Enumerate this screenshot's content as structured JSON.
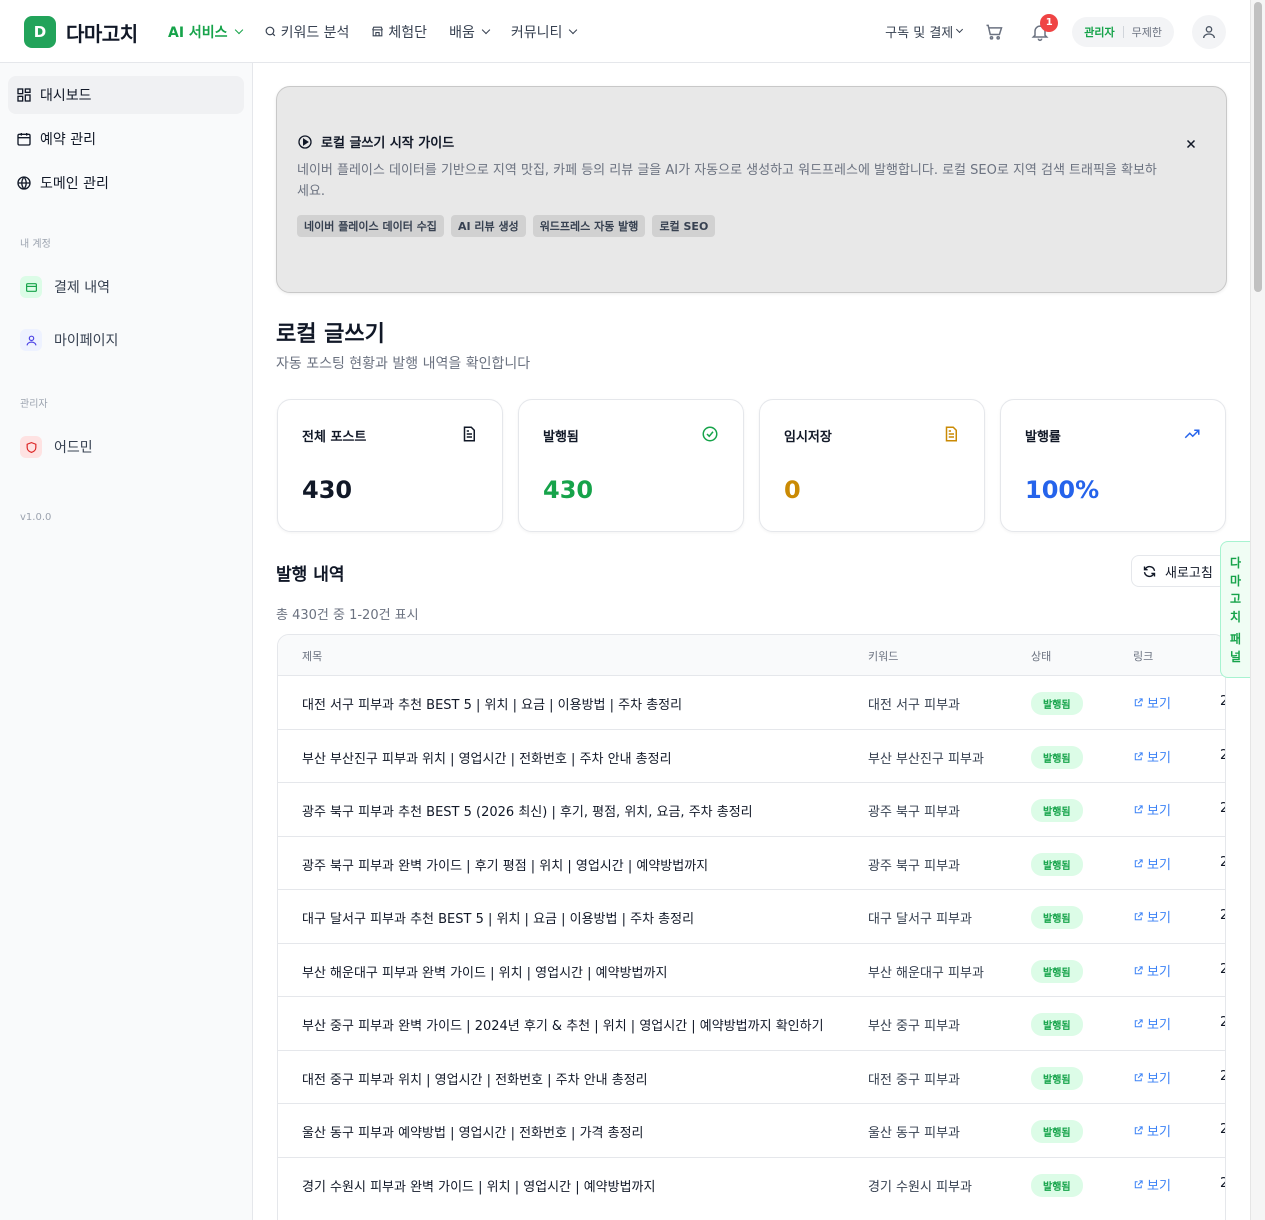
{
  "brand": {
    "badge": "D",
    "name": "다마고치",
    "accent": "#22a35a"
  },
  "nav": [
    {
      "label": "AI 서비스",
      "active": true,
      "dropdown": true,
      "icon": null
    },
    {
      "label": "키워드 분석",
      "active": false,
      "dropdown": false,
      "icon": "search-icon"
    },
    {
      "label": "체험단",
      "active": false,
      "dropdown": false,
      "icon": "store-icon"
    },
    {
      "label": "배움",
      "active": false,
      "dropdown": true,
      "icon": null
    },
    {
      "label": "커뮤니티",
      "active": false,
      "dropdown": true,
      "icon": null
    }
  ],
  "header": {
    "subscribe_label": "구독 및 결제",
    "notification_count": "1",
    "role": "관리자",
    "plan": "무제한"
  },
  "sidebar": {
    "items": [
      {
        "label": "대시보드",
        "icon": "dashboard-icon",
        "active": true
      },
      {
        "label": "예약 관리",
        "icon": "calendar-icon",
        "active": false
      },
      {
        "label": "도메인 관리",
        "icon": "globe-icon",
        "active": false
      }
    ],
    "account_section": "내 계정",
    "account_items": [
      {
        "label": "결제 내역",
        "icon": "credit-card-icon"
      },
      {
        "label": "마이페이지",
        "icon": "user-icon"
      }
    ],
    "admin_section": "관리자",
    "admin_items": [
      {
        "label": "어드민",
        "icon": "shield-icon"
      }
    ],
    "version": "v1.0.0"
  },
  "guide": {
    "title": "로컬 글쓰기 시작 가이드",
    "description": "네이버 플레이스 데이터를 기반으로 지역 맛집, 카페 등의 리뷰 글을 AI가 자동으로 생성하고 워드프레스에 발행합니다. 로컬 SEO로 지역 검색 트래픽을 확보하세요.",
    "tags": [
      "네이버 플레이스 데이터 수집",
      "AI 리뷰 생성",
      "워드프레스 자동 발행",
      "로컬 SEO"
    ]
  },
  "page": {
    "title": "로컬 글쓰기",
    "subtitle": "자동 포스팅 현황과 발행 내역을 확인합니다"
  },
  "stats": [
    {
      "label": "전체 포스트",
      "value": "430",
      "icon": "document-icon",
      "color": "#111827"
    },
    {
      "label": "발행됨",
      "value": "430",
      "icon": "check-circle-icon",
      "color": "#16a34a"
    },
    {
      "label": "임시저장",
      "value": "0",
      "icon": "draft-icon",
      "color": "#ca8a04"
    },
    {
      "label": "발행률",
      "value": "100%",
      "icon": "trending-up-icon",
      "color": "#2563eb"
    }
  ],
  "history": {
    "title": "발행 내역",
    "count_text": "총 430건 중 1-20건 표시",
    "refresh_label": "새로고침",
    "columns": [
      "제목",
      "키워드",
      "상태",
      "링크"
    ],
    "rows": [
      {
        "title": "대전 서구 피부과 추천 BEST 5 | 위치 | 요금 | 이용방법 | 주차 총정리",
        "keyword": "대전 서구 피부과",
        "status": "발행됨",
        "link": "보기",
        "date": "2"
      },
      {
        "title": "부산 부산진구 피부과 위치 | 영업시간 | 전화번호 | 주차 안내 총정리",
        "keyword": "부산 부산진구 피부과",
        "status": "발행됨",
        "link": "보기",
        "date": "2"
      },
      {
        "title": "광주 북구 피부과 추천 BEST 5 (2026 최신) | 후기, 평점, 위치, 요금, 주차 총정리",
        "keyword": "광주 북구 피부과",
        "status": "발행됨",
        "link": "보기",
        "date": "2"
      },
      {
        "title": "광주 북구 피부과 완벽 가이드 | 후기 평점 | 위치 | 영업시간 | 예약방법까지",
        "keyword": "광주 북구 피부과",
        "status": "발행됨",
        "link": "보기",
        "date": "2"
      },
      {
        "title": "대구 달서구 피부과 추천 BEST 5 | 위치 | 요금 | 이용방법 | 주차 총정리",
        "keyword": "대구 달서구 피부과",
        "status": "발행됨",
        "link": "보기",
        "date": "2"
      },
      {
        "title": "부산 해운대구 피부과 완벽 가이드 | 위치 | 영업시간 | 예약방법까지",
        "keyword": "부산 해운대구 피부과",
        "status": "발행됨",
        "link": "보기",
        "date": "2"
      },
      {
        "title": "부산 중구 피부과 완벽 가이드 | 2024년 후기 & 추천 | 위치 | 영업시간 | 예약방법까지 확인하기",
        "keyword": "부산 중구 피부과",
        "status": "발행됨",
        "link": "보기",
        "date": "2"
      },
      {
        "title": "대전 중구 피부과 위치 | 영업시간 | 전화번호 | 주차 안내 총정리",
        "keyword": "대전 중구 피부과",
        "status": "발행됨",
        "link": "보기",
        "date": "2"
      },
      {
        "title": "울산 동구 피부과 예약방법 | 영업시간 | 전화번호 | 가격 총정리",
        "keyword": "울산 동구 피부과",
        "status": "발행됨",
        "link": "보기",
        "date": "2"
      },
      {
        "title": "경기 수원시 피부과 완벽 가이드 | 위치 | 영업시간 | 예약방법까지",
        "keyword": "경기 수원시 피부과",
        "status": "발행됨",
        "link": "보기",
        "date": "2"
      }
    ]
  },
  "side_panel": {
    "chars": [
      "다",
      "마",
      "고",
      "치",
      "패",
      "널"
    ]
  }
}
